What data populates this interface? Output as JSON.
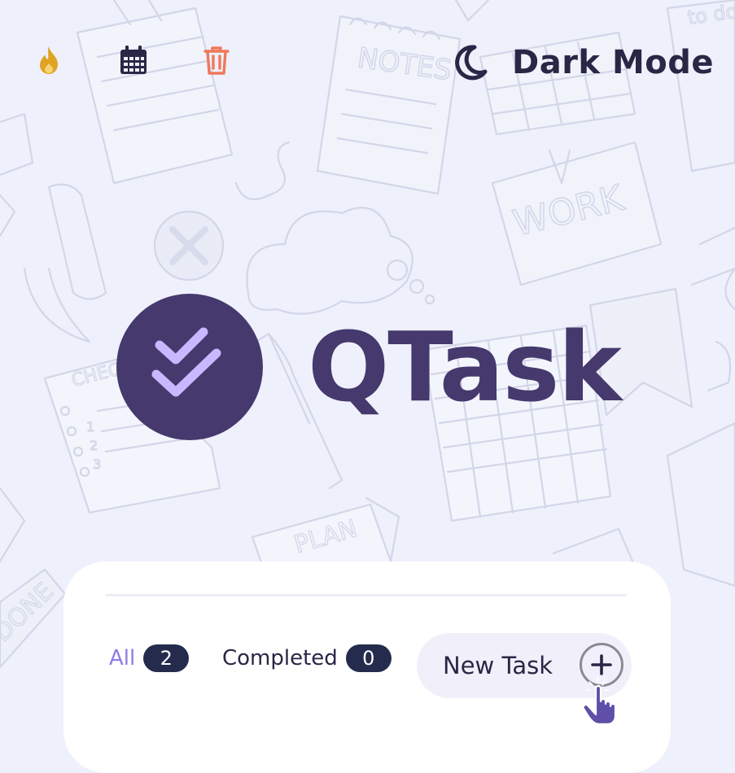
{
  "toolbar": {
    "icons": [
      "fire-icon",
      "calendar-icon",
      "trash-icon"
    ],
    "colors": {
      "fire": "#e0a323",
      "calendar": "#2a2645",
      "trash": "#f0785c"
    }
  },
  "theme_toggle": {
    "label": "Dark Mode",
    "icon": "moon-icon"
  },
  "logo": {
    "text": "QTask",
    "icon": "double-check-icon",
    "color": "#46396d",
    "accent": "#c9b8ff"
  },
  "background_doodles": {
    "notes": "NOTES",
    "work": "WORK",
    "plan": "PLAN",
    "checklist": "CHECK",
    "todo": "to do",
    "done": "DONE",
    "checklist_numbers": [
      "1",
      "2",
      "3"
    ]
  },
  "tasks_panel": {
    "filters": [
      {
        "label": "All",
        "count": "2",
        "active": true
      },
      {
        "label": "Completed",
        "count": "0",
        "active": false
      }
    ],
    "new_task_label": "New Task",
    "add_icon": "plus-icon"
  }
}
